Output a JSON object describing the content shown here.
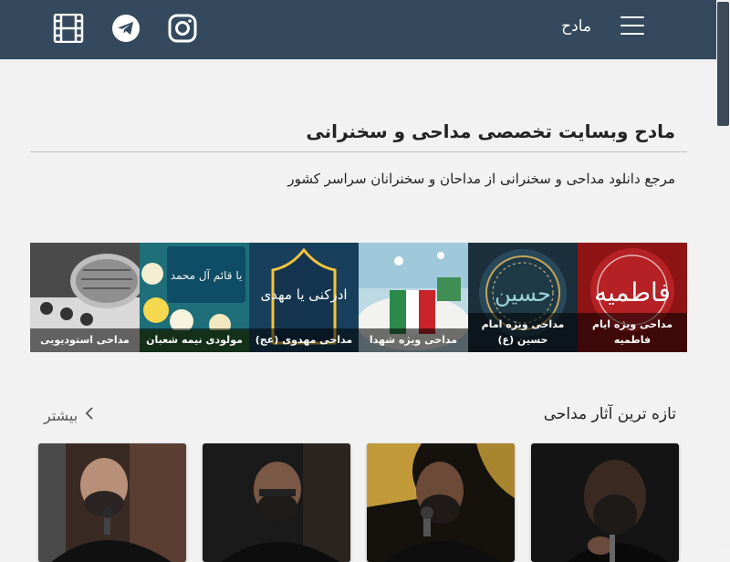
{
  "navbar": {
    "brand": "مادح",
    "bg_color": "#34495e",
    "icons": [
      "menu-icon",
      "instagram-icon",
      "telegram-icon",
      "film-icon"
    ]
  },
  "hero": {
    "title": "مادح وبسایت تخصصی مداحی و سخنرانی",
    "subtitle": "مرجع دانلود مداحی و سخنرانی از مداحان و سخنرانان سراسر کشور"
  },
  "categories": [
    {
      "label": "مداحی ویژه ایام فاطمیه",
      "image_text": "فاطمیه"
    },
    {
      "label": "مداحی ویژه امام حسین (ع)",
      "image_text": "حسین"
    },
    {
      "label": "مداحی ویژه شهدا"
    },
    {
      "label": "مداحی مهدوی (عج)",
      "image_text": "ادرکنی یا مهدی"
    },
    {
      "label": "مولودی نیمه شعبان",
      "image_text": "یا قائم آل محمد"
    },
    {
      "label": "مداحی استودیویی"
    }
  ],
  "latest": {
    "title": "تازه ترین آثار مداحی",
    "more_label": "بیشتر"
  }
}
